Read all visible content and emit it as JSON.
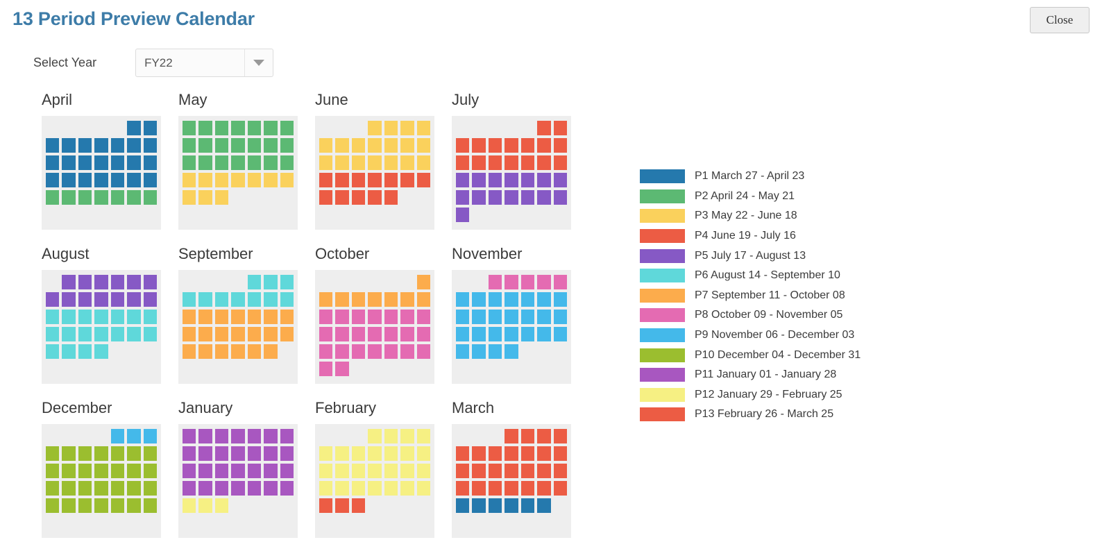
{
  "header": {
    "title": "13 Period Preview Calendar",
    "close_label": "Close"
  },
  "year_selector": {
    "label": "Select Year",
    "value": "FY22",
    "options": [
      "FY22"
    ],
    "arrow_icon": "chevron-down-icon"
  },
  "palette": {
    "P1": "#2579ad",
    "P2": "#5cb973",
    "P3": "#fad15c",
    "P4": "#ec5c44",
    "P5": "#8659c5",
    "P6": "#5fd8da",
    "P7": "#fcac4c",
    "P8": "#e46bb2",
    "P9": "#44b9ea",
    "P10": "#9bbe2f",
    "P11": "#a857c0",
    "P12": "#f6f083",
    "P13": "#ec5c44",
    "card_background": "#eeeeee",
    "title": "#3d7ca8"
  },
  "legend": {
    "items": [
      {
        "period": "P1",
        "label": "P1 March 27 - April 23",
        "color": "#2579ad"
      },
      {
        "period": "P2",
        "label": "P2 April 24 - May 21",
        "color": "#5cb973"
      },
      {
        "period": "P3",
        "label": "P3 May 22 - June 18",
        "color": "#fad15c"
      },
      {
        "period": "P4",
        "label": "P4 June 19 - July 16",
        "color": "#ec5c44"
      },
      {
        "period": "P5",
        "label": "P5 July 17 - August 13",
        "color": "#8659c5"
      },
      {
        "period": "P6",
        "label": "P6 August 14 - September 10",
        "color": "#5fd8da"
      },
      {
        "period": "P7",
        "label": "P7 September 11 - October 08",
        "color": "#fcac4c"
      },
      {
        "period": "P8",
        "label": "P8 October 09 - November 05",
        "color": "#e46bb2"
      },
      {
        "period": "P9",
        "label": "P9 November 06 - December 03",
        "color": "#44b9ea"
      },
      {
        "period": "P10",
        "label": "P10 December 04 - December 31",
        "color": "#9bbe2f"
      },
      {
        "period": "P11",
        "label": "P11 January 01 - January 28",
        "color": "#a857c0"
      },
      {
        "period": "P12",
        "label": "P12 January 29 - February 25",
        "color": "#f6f083"
      },
      {
        "period": "P13",
        "label": "P13 February 26 - March 25",
        "color": "#ec5c44"
      }
    ]
  },
  "calendar": {
    "months": [
      {
        "name": "April",
        "rows": [
          [
            null,
            null,
            null,
            null,
            null,
            "P1",
            "P1"
          ],
          [
            "P1",
            "P1",
            "P1",
            "P1",
            "P1",
            "P1",
            "P1"
          ],
          [
            "P1",
            "P1",
            "P1",
            "P1",
            "P1",
            "P1",
            "P1"
          ],
          [
            "P1",
            "P1",
            "P1",
            "P1",
            "P1",
            "P1",
            "P1"
          ],
          [
            "P2",
            "P2",
            "P2",
            "P2",
            "P2",
            "P2",
            "P2"
          ],
          [
            null,
            null,
            null,
            null,
            null,
            null,
            null
          ]
        ]
      },
      {
        "name": "May",
        "rows": [
          [
            "P2",
            "P2",
            "P2",
            "P2",
            "P2",
            "P2",
            "P2"
          ],
          [
            "P2",
            "P2",
            "P2",
            "P2",
            "P2",
            "P2",
            "P2"
          ],
          [
            "P2",
            "P2",
            "P2",
            "P2",
            "P2",
            "P2",
            "P2"
          ],
          [
            "P3",
            "P3",
            "P3",
            "P3",
            "P3",
            "P3",
            "P3"
          ],
          [
            "P3",
            "P3",
            "P3",
            null,
            null,
            null,
            null
          ],
          [
            null,
            null,
            null,
            null,
            null,
            null,
            null
          ]
        ]
      },
      {
        "name": "June",
        "rows": [
          [
            null,
            null,
            null,
            "P3",
            "P3",
            "P3",
            "P3"
          ],
          [
            "P3",
            "P3",
            "P3",
            "P3",
            "P3",
            "P3",
            "P3"
          ],
          [
            "P3",
            "P3",
            "P3",
            "P3",
            "P3",
            "P3",
            "P3"
          ],
          [
            "P4",
            "P4",
            "P4",
            "P4",
            "P4",
            "P4",
            "P4"
          ],
          [
            "P4",
            "P4",
            "P4",
            "P4",
            "P4",
            null,
            null
          ],
          [
            null,
            null,
            null,
            null,
            null,
            null,
            null
          ]
        ]
      },
      {
        "name": "July",
        "rows": [
          [
            null,
            null,
            null,
            null,
            null,
            "P4",
            "P4"
          ],
          [
            "P4",
            "P4",
            "P4",
            "P4",
            "P4",
            "P4",
            "P4"
          ],
          [
            "P4",
            "P4",
            "P4",
            "P4",
            "P4",
            "P4",
            "P4"
          ],
          [
            "P5",
            "P5",
            "P5",
            "P5",
            "P5",
            "P5",
            "P5"
          ],
          [
            "P5",
            "P5",
            "P5",
            "P5",
            "P5",
            "P5",
            "P5"
          ],
          [
            "P5",
            null,
            null,
            null,
            null,
            null,
            null
          ]
        ]
      },
      {
        "name": "August",
        "rows": [
          [
            null,
            "P5",
            "P5",
            "P5",
            "P5",
            "P5",
            "P5"
          ],
          [
            "P5",
            "P5",
            "P5",
            "P5",
            "P5",
            "P5",
            "P5"
          ],
          [
            "P6",
            "P6",
            "P6",
            "P6",
            "P6",
            "P6",
            "P6"
          ],
          [
            "P6",
            "P6",
            "P6",
            "P6",
            "P6",
            "P6",
            "P6"
          ],
          [
            "P6",
            "P6",
            "P6",
            "P6",
            null,
            null,
            null
          ],
          [
            null,
            null,
            null,
            null,
            null,
            null,
            null
          ]
        ]
      },
      {
        "name": "September",
        "rows": [
          [
            null,
            null,
            null,
            null,
            "P6",
            "P6",
            "P6"
          ],
          [
            "P6",
            "P6",
            "P6",
            "P6",
            "P6",
            "P6",
            "P6"
          ],
          [
            "P7",
            "P7",
            "P7",
            "P7",
            "P7",
            "P7",
            "P7"
          ],
          [
            "P7",
            "P7",
            "P7",
            "P7",
            "P7",
            "P7",
            "P7"
          ],
          [
            "P7",
            "P7",
            "P7",
            "P7",
            "P7",
            "P7",
            null
          ],
          [
            null,
            null,
            null,
            null,
            null,
            null,
            null
          ]
        ]
      },
      {
        "name": "October",
        "rows": [
          [
            null,
            null,
            null,
            null,
            null,
            null,
            "P7"
          ],
          [
            "P7",
            "P7",
            "P7",
            "P7",
            "P7",
            "P7",
            "P7"
          ],
          [
            "P8",
            "P8",
            "P8",
            "P8",
            "P8",
            "P8",
            "P8"
          ],
          [
            "P8",
            "P8",
            "P8",
            "P8",
            "P8",
            "P8",
            "P8"
          ],
          [
            "P8",
            "P8",
            "P8",
            "P8",
            "P8",
            "P8",
            "P8"
          ],
          [
            "P8",
            "P8",
            null,
            null,
            null,
            null,
            null
          ]
        ]
      },
      {
        "name": "November",
        "rows": [
          [
            null,
            null,
            "P8",
            "P8",
            "P8",
            "P8",
            "P8"
          ],
          [
            "P9",
            "P9",
            "P9",
            "P9",
            "P9",
            "P9",
            "P9"
          ],
          [
            "P9",
            "P9",
            "P9",
            "P9",
            "P9",
            "P9",
            "P9"
          ],
          [
            "P9",
            "P9",
            "P9",
            "P9",
            "P9",
            "P9",
            "P9"
          ],
          [
            "P9",
            "P9",
            "P9",
            "P9",
            null,
            null,
            null
          ],
          [
            null,
            null,
            null,
            null,
            null,
            null,
            null
          ]
        ]
      },
      {
        "name": "December",
        "rows": [
          [
            null,
            null,
            null,
            null,
            "P9",
            "P9",
            "P9"
          ],
          [
            "P10",
            "P10",
            "P10",
            "P10",
            "P10",
            "P10",
            "P10"
          ],
          [
            "P10",
            "P10",
            "P10",
            "P10",
            "P10",
            "P10",
            "P10"
          ],
          [
            "P10",
            "P10",
            "P10",
            "P10",
            "P10",
            "P10",
            "P10"
          ],
          [
            "P10",
            "P10",
            "P10",
            "P10",
            "P10",
            "P10",
            "P10"
          ],
          [
            null,
            null,
            null,
            null,
            null,
            null,
            null
          ]
        ]
      },
      {
        "name": "January",
        "rows": [
          [
            "P11",
            "P11",
            "P11",
            "P11",
            "P11",
            "P11",
            "P11"
          ],
          [
            "P11",
            "P11",
            "P11",
            "P11",
            "P11",
            "P11",
            "P11"
          ],
          [
            "P11",
            "P11",
            "P11",
            "P11",
            "P11",
            "P11",
            "P11"
          ],
          [
            "P11",
            "P11",
            "P11",
            "P11",
            "P11",
            "P11",
            "P11"
          ],
          [
            "P12",
            "P12",
            "P12",
            null,
            null,
            null,
            null
          ],
          [
            null,
            null,
            null,
            null,
            null,
            null,
            null
          ]
        ]
      },
      {
        "name": "February",
        "rows": [
          [
            null,
            null,
            null,
            "P12",
            "P12",
            "P12",
            "P12"
          ],
          [
            "P12",
            "P12",
            "P12",
            "P12",
            "P12",
            "P12",
            "P12"
          ],
          [
            "P12",
            "P12",
            "P12",
            "P12",
            "P12",
            "P12",
            "P12"
          ],
          [
            "P12",
            "P12",
            "P12",
            "P12",
            "P12",
            "P12",
            "P12"
          ],
          [
            "P13",
            "P13",
            "P13",
            null,
            null,
            null,
            null
          ],
          [
            null,
            null,
            null,
            null,
            null,
            null,
            null
          ]
        ]
      },
      {
        "name": "March",
        "rows": [
          [
            null,
            null,
            null,
            "P13",
            "P13",
            "P13",
            "P13"
          ],
          [
            "P13",
            "P13",
            "P13",
            "P13",
            "P13",
            "P13",
            "P13"
          ],
          [
            "P13",
            "P13",
            "P13",
            "P13",
            "P13",
            "P13",
            "P13"
          ],
          [
            "P13",
            "P13",
            "P13",
            "P13",
            "P13",
            "P13",
            "P13"
          ],
          [
            "P1",
            "P1",
            "P1",
            "P1",
            "P1",
            "P1",
            null
          ],
          [
            null,
            null,
            null,
            null,
            null,
            null,
            null
          ]
        ]
      }
    ]
  }
}
